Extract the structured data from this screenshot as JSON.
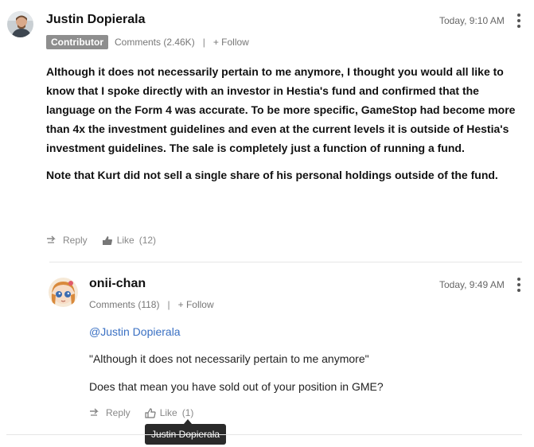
{
  "comment": {
    "author": "Justin Dopierala",
    "time": "Today, 9:10 AM",
    "badge": "Contributor",
    "comments_count": "Comments (2.46K)",
    "follow": "+ Follow",
    "paragraphs": [
      "Although it does not necessarily pertain to me anymore, I thought you would all like to know that I spoke directly with an investor in Hestia's fund and confirmed that the language on the Form 4 was accurate. To be more specific, GameStop had become more than 4x the investment guidelines and even at the current levels it is outside of Hestia's investment guidelines. The sale is completely just a function of running a fund.",
      "Note that Kurt did not sell a single share of his personal holdings outside of the fund."
    ],
    "reply": "Reply",
    "like": "Like",
    "like_count": "(12)"
  },
  "reply_comment": {
    "author": "onii-chan",
    "time": "Today, 9:49 AM",
    "comments_count": "Comments (118)",
    "follow": "+ Follow",
    "mention": "@Justin Dopierala",
    "quote": "\"Although it does not necessarily pertain to me anymore\"",
    "question": "Does that mean you have sold out of your position in GME?",
    "reply": "Reply",
    "like": "Like",
    "like_count": "(1)"
  },
  "tooltip": {
    "text": "Justin Dopierala"
  },
  "separator": "|",
  "icons": {
    "reply": "reply-arrow-icon",
    "like": "thumbs-up-icon",
    "more": "kebab-menu-icon"
  }
}
